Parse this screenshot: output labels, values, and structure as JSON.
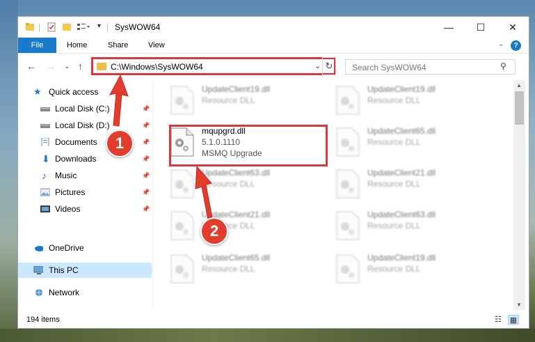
{
  "window": {
    "title": "SysWOW64",
    "controls": {
      "minimize": "—",
      "maximize": "☐",
      "close": "✕"
    }
  },
  "ribbon": {
    "tabs": [
      "File",
      "Home",
      "Share",
      "View"
    ],
    "help": "?"
  },
  "address": {
    "path": "C:\\Windows\\SysWOW64",
    "search_placeholder": "Search SysWOW64"
  },
  "sidebar": {
    "items": [
      {
        "label": "Quick access",
        "icon": "star-icon"
      },
      {
        "label": "Local Disk (C:)",
        "icon": "drive-icon",
        "pinned": true
      },
      {
        "label": "Local Disk (D:)",
        "icon": "drive-icon",
        "pinned": true
      },
      {
        "label": "Documents",
        "icon": "documents-icon",
        "pinned": true
      },
      {
        "label": "Downloads",
        "icon": "download-icon",
        "pinned": true
      },
      {
        "label": "Music",
        "icon": "music-icon",
        "pinned": true
      },
      {
        "label": "Pictures",
        "icon": "pictures-icon",
        "pinned": true
      },
      {
        "label": "Videos",
        "icon": "videos-icon",
        "pinned": true
      },
      {
        "label": "OneDrive",
        "icon": "cloud-icon"
      },
      {
        "label": "This PC",
        "icon": "computer-icon",
        "selected": true
      },
      {
        "label": "Network",
        "icon": "network-icon"
      }
    ]
  },
  "files": {
    "highlighted": {
      "name": "mqupgrd.dll",
      "version": "5.1.0.1110",
      "description": "MSMQ Upgrade"
    },
    "blurred": [
      {
        "name": "UpdateClient19.dll",
        "description": "Resource DLL"
      },
      {
        "name": "UpdateClient19.dll",
        "description": "Resource DLL"
      },
      {
        "name": "UpdateClient65.dll",
        "description": "Resource DLL"
      },
      {
        "name": "UpdateClient63.dll",
        "description": "Resource DLL"
      },
      {
        "name": "UpdateClient21.dll",
        "description": "Resource DLL"
      },
      {
        "name": "UpdateClient21.dll",
        "description": "Resource DLL"
      },
      {
        "name": "UpdateClient63.dll",
        "description": "Resource DLL"
      },
      {
        "name": "UpdateClient65.dll",
        "description": "Resource DLL"
      },
      {
        "name": "UpdateClient19.dll",
        "description": "Resource DLL"
      }
    ]
  },
  "status": {
    "items_count": "194 items"
  },
  "callouts": {
    "step1": "1",
    "step2": "2"
  },
  "colors": {
    "accent": "#1979ca",
    "callout": "#e23c2c",
    "highlight_border": "#d9363e",
    "selection": "#cce8ff"
  }
}
